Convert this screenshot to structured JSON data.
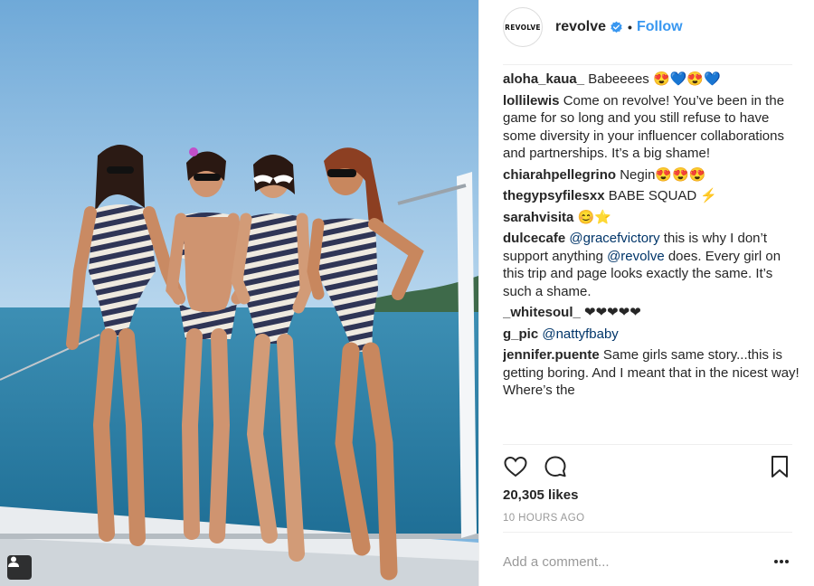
{
  "post": {
    "author": "revolve",
    "avatar_text": "REVOLVE",
    "verified_icon": "verified-badge-icon",
    "follow_label": "Follow",
    "separator": "•",
    "likes": "20,305 likes",
    "timestamp": "10 HOURS AGO",
    "comment_placeholder": "Add a comment...",
    "more_icon": "ellipsis-icon"
  },
  "comments": [
    {
      "author": "aloha_kaua_",
      "parts": [
        {
          "text": " Babeeees 😍💙😍💙"
        }
      ]
    },
    {
      "author": "lollilewis",
      "parts": [
        {
          "text": " Come on revolve! You’ve been in the game for so long and you still refuse to have some diversity in your influencer collaborations and partnerships. It’s a big shame!"
        }
      ]
    },
    {
      "author": "chiarahpellegrino",
      "parts": [
        {
          "text": " Negin😍😍😍"
        }
      ]
    },
    {
      "author": "thegypsyfilesxx",
      "parts": [
        {
          "text": " BABE SQUAD ⚡"
        }
      ]
    },
    {
      "author": "sarahvisita",
      "parts": [
        {
          "text": " 😊⭐"
        }
      ]
    },
    {
      "author": "dulcecafe",
      "parts": [
        {
          "text": " "
        },
        {
          "text": "@gracefvictory",
          "mention": true
        },
        {
          "text": " this is why I don’t support anything "
        },
        {
          "text": "@revolve",
          "mention": true
        },
        {
          "text": " does. Every girl on this trip and page looks exactly the same. It’s such a shame."
        }
      ]
    },
    {
      "author": "_whitesoul_",
      "parts": [
        {
          "text": " ❤❤❤❤❤"
        }
      ]
    },
    {
      "author": "g_pic",
      "parts": [
        {
          "text": " "
        },
        {
          "text": "@nattyfbaby",
          "mention": true
        }
      ]
    },
    {
      "author": "jennifer.puente",
      "parts": [
        {
          "text": " Same girls same story...this is getting boring. And I meant that in the nicest way! Where’s the"
        }
      ]
    }
  ],
  "icons": {
    "like": "heart-icon",
    "comment": "comment-bubble-icon",
    "save": "bookmark-icon",
    "tag": "user-tag-icon"
  },
  "colors": {
    "link": "#3897f0",
    "text": "#262626",
    "muted": "#999999",
    "mention": "#003569",
    "sky": "#7fb6df",
    "sea": "#2b7fa6"
  }
}
